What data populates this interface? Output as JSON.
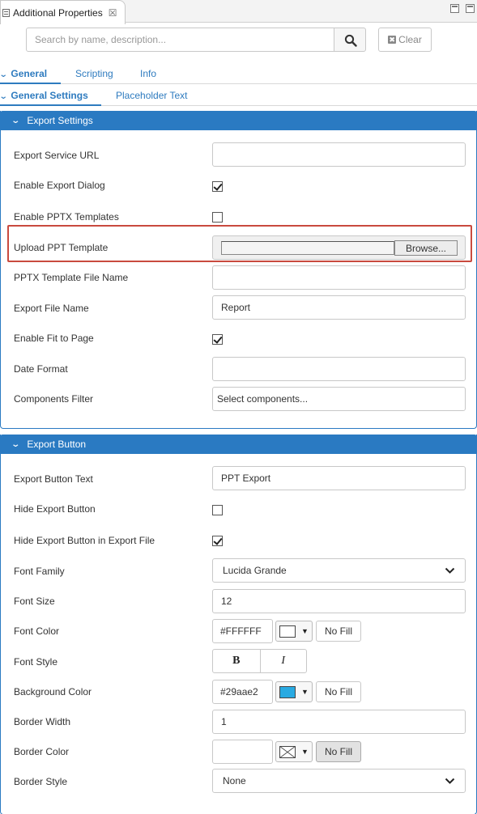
{
  "window": {
    "tab_title": "Additional Properties",
    "close_glyph": "☒"
  },
  "search": {
    "placeholder": "Search by name, description...",
    "clear_label": "Clear",
    "clear_glyph": "✖"
  },
  "tabs": [
    {
      "label": "General",
      "active": true
    },
    {
      "label": "Scripting",
      "active": false
    },
    {
      "label": "Info",
      "active": false
    }
  ],
  "subtabs": [
    {
      "label": "General Settings",
      "active": true
    },
    {
      "label": "Placeholder Text",
      "active": false
    }
  ],
  "chevron_glyph": "⌵",
  "export_settings": {
    "header": "Export Settings",
    "fields": {
      "service_url": {
        "label": "Export Service URL",
        "value": ""
      },
      "enable_dialog": {
        "label": "Enable Export Dialog",
        "checked": true
      },
      "enable_pptx_templates": {
        "label": "Enable PPTX Templates",
        "checked": false
      },
      "upload_template": {
        "label": "Upload PPT Template",
        "button": "Browse..."
      },
      "template_file_name": {
        "label": "PPTX Template File Name",
        "value": ""
      },
      "file_name": {
        "label": "Export File Name",
        "value": "Report"
      },
      "fit_to_page": {
        "label": "Enable Fit to Page",
        "checked": true
      },
      "date_format": {
        "label": "Date Format",
        "value": ""
      },
      "components_filter": {
        "label": "Components Filter",
        "placeholder": "Select components..."
      }
    }
  },
  "export_button": {
    "header": "Export Button",
    "fields": {
      "button_text": {
        "label": "Export Button Text",
        "value": "PPT Export"
      },
      "hide_button": {
        "label": "Hide Export Button",
        "checked": false
      },
      "hide_in_file": {
        "label": "Hide Export Button in Export File",
        "checked": true
      },
      "font_family": {
        "label": "Font Family",
        "value": "Lucida Grande"
      },
      "font_size": {
        "label": "Font Size",
        "value": "12"
      },
      "font_color": {
        "label": "Font Color",
        "value": "#FFFFFF",
        "swatch": "#FFFFFF",
        "nofill": "No Fill"
      },
      "font_style": {
        "label": "Font Style",
        "bold": "B",
        "italic": "I"
      },
      "background_color": {
        "label": "Background Color",
        "value": "#29aae2",
        "swatch": "#29aae2",
        "nofill": "No Fill"
      },
      "border_width": {
        "label": "Border Width",
        "value": "1"
      },
      "border_color": {
        "label": "Border Color",
        "value": "",
        "nofill": "No Fill"
      },
      "border_style": {
        "label": "Border Style",
        "value": "None"
      }
    }
  },
  "colors": {
    "accent": "#2a7ac2",
    "highlight": "#c94a3e",
    "link": "#2e7bbf"
  }
}
